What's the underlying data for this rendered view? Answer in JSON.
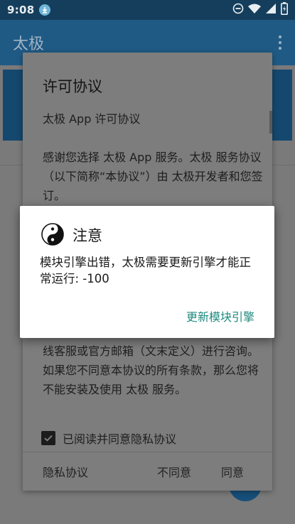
{
  "status_bar": {
    "time": "9:08",
    "icons": [
      "download-icon",
      "dnd-icon",
      "wifi-icon",
      "signal-icon",
      "battery-icon"
    ]
  },
  "app_bar": {
    "title": "太极",
    "menu_icon": "more-vert-icon"
  },
  "license_dialog": {
    "title": "许可协议",
    "heading": "太极 App 许可协议",
    "paragraph_1": "感谢您选择 太极 App 服务。太极 服务协议（以下简称“本协议”）由 太极开发者和您签订。",
    "paragraph_2": "有疑问，您可通过本网站（下文定义）的在线客服或官方邮箱（文末定义）进行咨询。如果您不同意本协议的所有条款，那么您将不能安装及使用 太极 服务。",
    "agree_checkbox_label": "已阅读并同意隐私协议",
    "agree_checked": true,
    "privacy_button": "隐私协议",
    "disagree_button": "不同意",
    "agree_button": "同意"
  },
  "notice_dialog": {
    "icon": "yin-yang-icon",
    "title": "注意",
    "message": "模块引擎出错，太极需要更新引擎才能正常运行: -100",
    "action_button": "更新模块引擎"
  },
  "colors": {
    "status_bar": "#153e5c",
    "app_bar": "#1f5a85",
    "scrim_page": "#7a7a7a",
    "accent_button": "#1f8a7e"
  }
}
